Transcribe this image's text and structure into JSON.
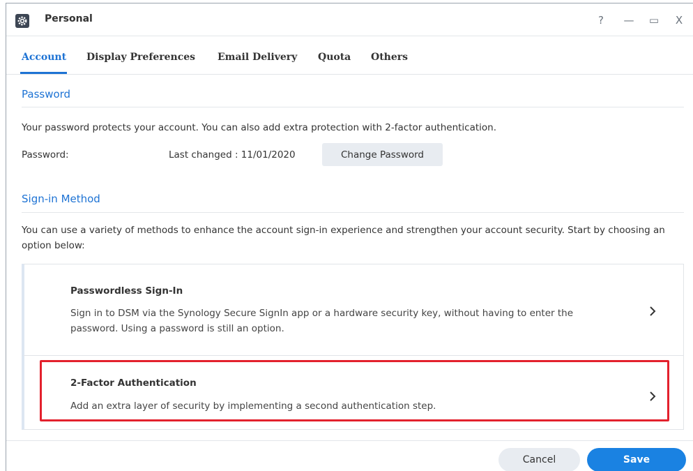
{
  "window": {
    "title": "Personal",
    "help_glyph": "?",
    "minimize_glyph": "—",
    "maximize_glyph": "▭",
    "close_glyph": "X"
  },
  "tabs": [
    {
      "label": "Account",
      "active": true
    },
    {
      "label": "Display Preferences",
      "active": false
    },
    {
      "label": "Email Delivery",
      "active": false
    },
    {
      "label": "Quota",
      "active": false
    },
    {
      "label": "Others",
      "active": false
    }
  ],
  "password_section": {
    "title": "Password",
    "description": "Your password protects your account. You can also add extra protection with 2-factor authentication.",
    "field_label": "Password:",
    "last_changed": "Last changed : 11/01/2020",
    "change_button": "Change Password"
  },
  "signin_section": {
    "title": "Sign-in Method",
    "description": "You can use a variety of methods to enhance the account sign-in experience and strengthen your account security. Start by choosing an option below:",
    "options": [
      {
        "title": "Passwordless Sign-In",
        "description": "Sign in to DSM via the Synology Secure SignIn app or a hardware security key, without having to enter the password. Using a password is still an option."
      },
      {
        "title": "2-Factor Authentication",
        "description": "Add an extra layer of security by implementing a second authentication step."
      }
    ]
  },
  "footer": {
    "cancel_label": "Cancel",
    "save_label": "Save"
  },
  "colors": {
    "accent": "#1e73d4",
    "save_button": "#1a82e2",
    "highlight_border": "#e3212d"
  },
  "icons": {
    "app": "gear-icon",
    "option_arrow": "chevron-right-icon"
  }
}
